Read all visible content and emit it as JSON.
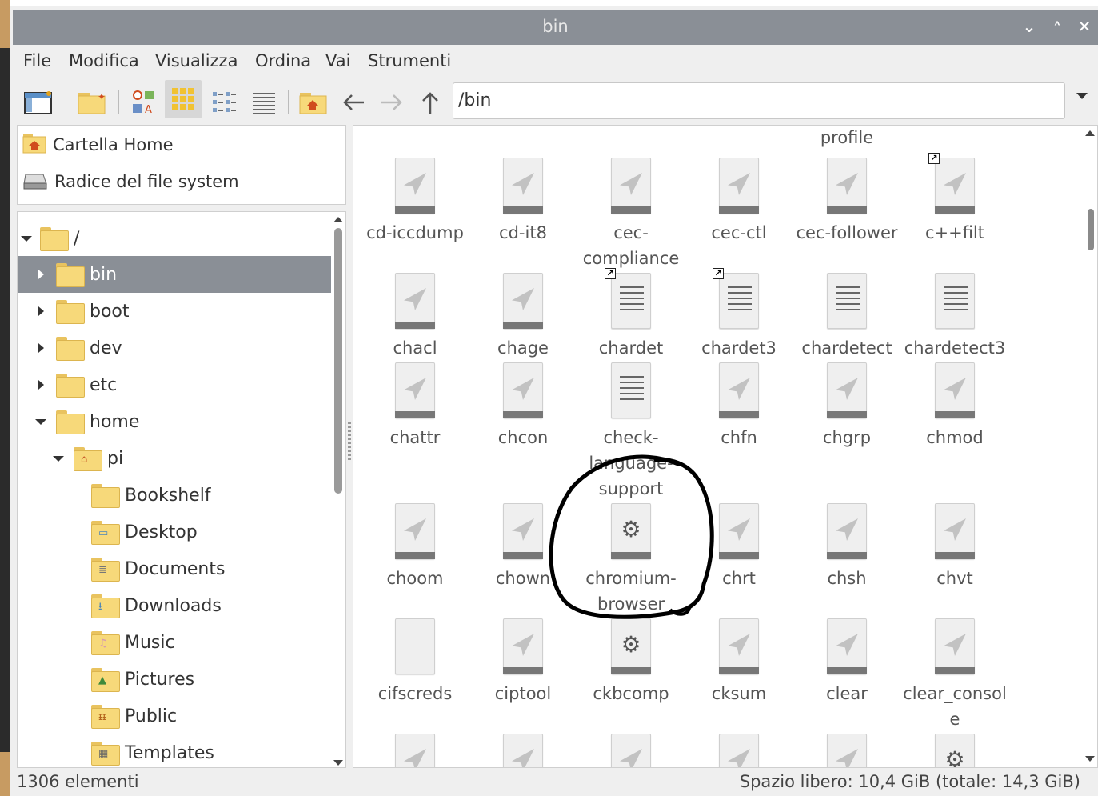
{
  "window": {
    "title": "bin",
    "controls": [
      "chevron-down",
      "chevron-up",
      "close"
    ]
  },
  "menubar": [
    "File",
    "Modifica",
    "Visualizza",
    "Ordina",
    "Vai",
    "Strumenti"
  ],
  "toolbar": {
    "buttons": [
      "new-window",
      "new-folder",
      "icon-view",
      "thumbnail-view",
      "compact-view",
      "detailed-list-view",
      "home",
      "back",
      "forward",
      "up"
    ],
    "active": "thumbnail-view",
    "path": "/bin"
  },
  "places": [
    {
      "label": "Cartella Home",
      "icon": "home-folder-icon"
    },
    {
      "label": "Radice del file system",
      "icon": "drive-icon"
    }
  ],
  "tree": [
    {
      "label": "/",
      "expander": "down",
      "level": 0
    },
    {
      "label": "bin",
      "expander": "right",
      "level": 1,
      "selected": true
    },
    {
      "label": "boot",
      "expander": "right",
      "level": 1
    },
    {
      "label": "dev",
      "expander": "right",
      "level": 1
    },
    {
      "label": "etc",
      "expander": "right",
      "level": 1
    },
    {
      "label": "home",
      "expander": "down",
      "level": 1
    },
    {
      "label": "pi",
      "expander": "down",
      "level": 2,
      "icon": "home"
    },
    {
      "label": "Bookshelf",
      "level": 3
    },
    {
      "label": "Desktop",
      "level": 3,
      "icon": "desktop"
    },
    {
      "label": "Documents",
      "level": 3,
      "icon": "documents"
    },
    {
      "label": "Downloads",
      "level": 3,
      "icon": "downloads"
    },
    {
      "label": "Music",
      "level": 3,
      "icon": "music"
    },
    {
      "label": "Pictures",
      "level": 3,
      "icon": "pictures"
    },
    {
      "label": "Public",
      "level": 3,
      "icon": "public"
    },
    {
      "label": "Templates",
      "level": 3,
      "icon": "templates"
    }
  ],
  "files": {
    "partial_top_label": "profile",
    "rows": [
      [
        {
          "name": "cd-iccdump",
          "type": "exe"
        },
        {
          "name": "cd-it8",
          "type": "exe"
        },
        {
          "name": "cec-\ncompliance",
          "type": "exe"
        },
        {
          "name": "cec-ctl",
          "type": "exe"
        },
        {
          "name": "cec-follower",
          "type": "exe"
        },
        {
          "name": "c++filt",
          "type": "exe",
          "link": true
        }
      ],
      [
        {
          "name": "chacl",
          "type": "exe"
        },
        {
          "name": "chage",
          "type": "exe"
        },
        {
          "name": "chardet",
          "type": "txt",
          "link": true
        },
        {
          "name": "chardet3",
          "type": "txt",
          "link": true
        },
        {
          "name": "chardetect",
          "type": "txt"
        },
        {
          "name": "chardetect3",
          "type": "txt"
        }
      ],
      [
        {
          "name": "chattr",
          "type": "exe"
        },
        {
          "name": "chcon",
          "type": "exe"
        },
        {
          "name": "check-\nlanguage-\nsupport",
          "type": "txt"
        },
        {
          "name": "chfn",
          "type": "exe"
        },
        {
          "name": "chgrp",
          "type": "exe"
        },
        {
          "name": "chmod",
          "type": "exe"
        }
      ],
      [
        {
          "name": "choom",
          "type": "exe"
        },
        {
          "name": "chown",
          "type": "exe"
        },
        {
          "name": "chromium-\nbrowser",
          "type": "sh"
        },
        {
          "name": "chrt",
          "type": "exe"
        },
        {
          "name": "chsh",
          "type": "exe"
        },
        {
          "name": "chvt",
          "type": "exe"
        }
      ],
      [
        {
          "name": "cifscreds",
          "type": "blank"
        },
        {
          "name": "ciptool",
          "type": "exe"
        },
        {
          "name": "ckbcomp",
          "type": "sh"
        },
        {
          "name": "cksum",
          "type": "exe"
        },
        {
          "name": "clear",
          "type": "exe"
        },
        {
          "name": "clear_consol\ne",
          "type": "exe"
        }
      ],
      [
        {
          "name": "",
          "type": "exe"
        },
        {
          "name": "",
          "type": "exe"
        },
        {
          "name": "",
          "type": "exe"
        },
        {
          "name": "",
          "type": "exe"
        },
        {
          "name": "",
          "type": "exe"
        },
        {
          "name": "",
          "type": "sh"
        }
      ]
    ]
  },
  "status": {
    "count": "1306 elementi",
    "free_space": "Spazio libero: 10,4 GiB (totale: 14,3 GiB)"
  },
  "colors": {
    "titlebar": "#8a8f96",
    "selection": "#8a8f96",
    "folder": "#f7d97a",
    "annotation": "#000000"
  }
}
